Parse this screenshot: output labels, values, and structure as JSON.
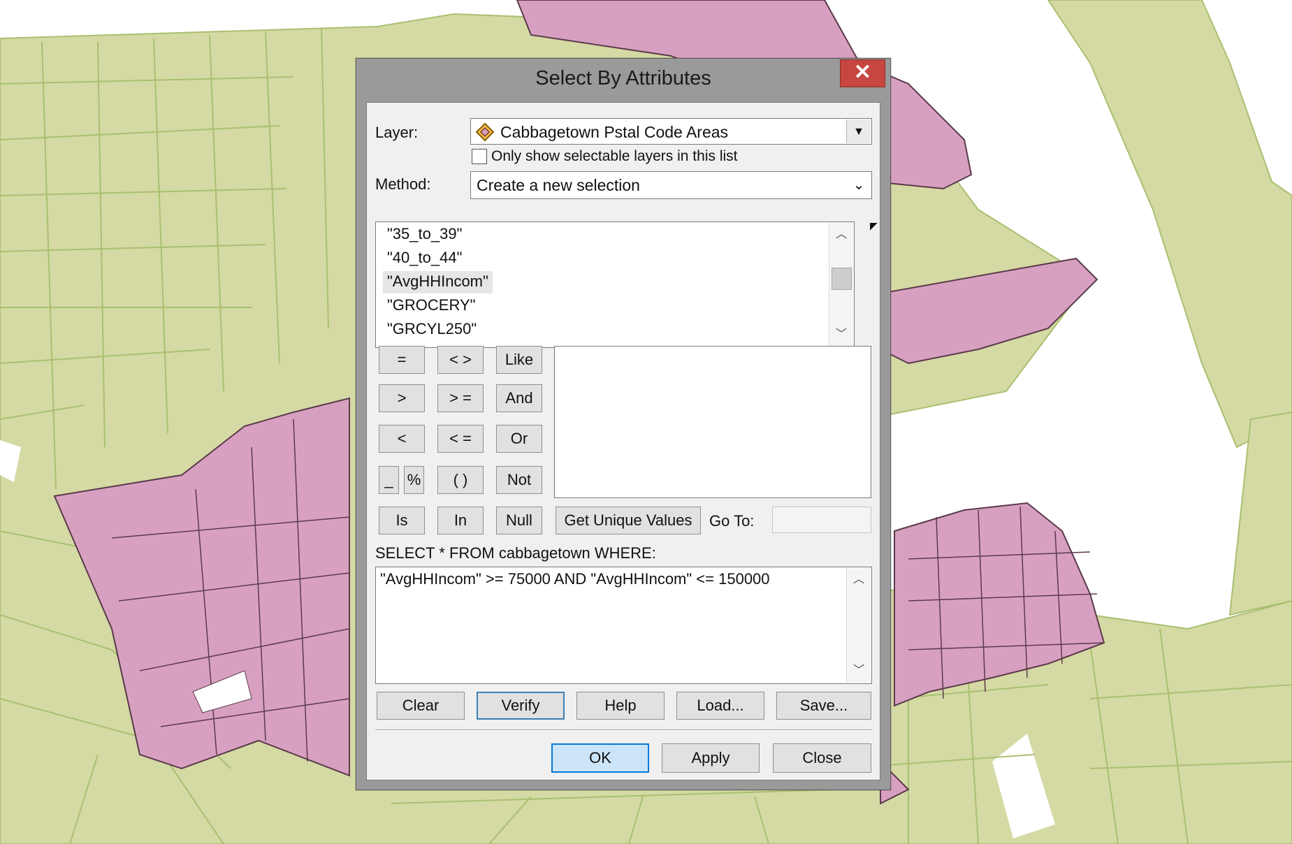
{
  "dialog": {
    "title": "Select By Attributes",
    "close_glyph": "✕"
  },
  "layer": {
    "label": "Layer:",
    "value": "Cabbagetown Pstal Code Areas",
    "icon": "polygon-layer-icon",
    "only_selectable_label": "Only show selectable layers in this list",
    "only_selectable_checked": false
  },
  "method": {
    "label": "Method:",
    "value": "Create a new selection"
  },
  "fields": {
    "items": [
      "\"35_to_39\"",
      "\"40_to_44\"",
      "\"AvgHHIncom\"",
      "\"GROCERY\"",
      "\"GRCYL250\""
    ],
    "selected_index": 2
  },
  "operators": {
    "eq": "=",
    "ne": "< >",
    "like": "Like",
    "gt": ">",
    "ge": "> =",
    "and": "And",
    "lt": "<",
    "le": "< =",
    "or": "Or",
    "underscore": "_",
    "percent": "%",
    "parens": "( )",
    "not": "Not",
    "is": "Is",
    "in": "In",
    "null": "Null"
  },
  "unique": {
    "button_label": "Get Unique Values",
    "goto_label": "Go To:",
    "goto_value": ""
  },
  "query": {
    "prefix": "SELECT * FROM cabbagetown WHERE:",
    "expression": "\"AvgHHIncom\" >= 75000 AND \"AvgHHIncom\" <= 150000"
  },
  "actions": {
    "clear": "Clear",
    "verify": "Verify",
    "help": "Help",
    "load": "Load...",
    "save": "Save..."
  },
  "footer": {
    "ok": "OK",
    "apply": "Apply",
    "close": "Close"
  },
  "colors": {
    "map_background": "#ffffff",
    "parcel_green": "#d5d9a4",
    "parcel_green_outline": "#a8c070",
    "selected_pink": "#d8a0c0",
    "selected_outline": "#5a3a4a",
    "close_button": "#c7463f",
    "default_button": "#cce4f7"
  }
}
